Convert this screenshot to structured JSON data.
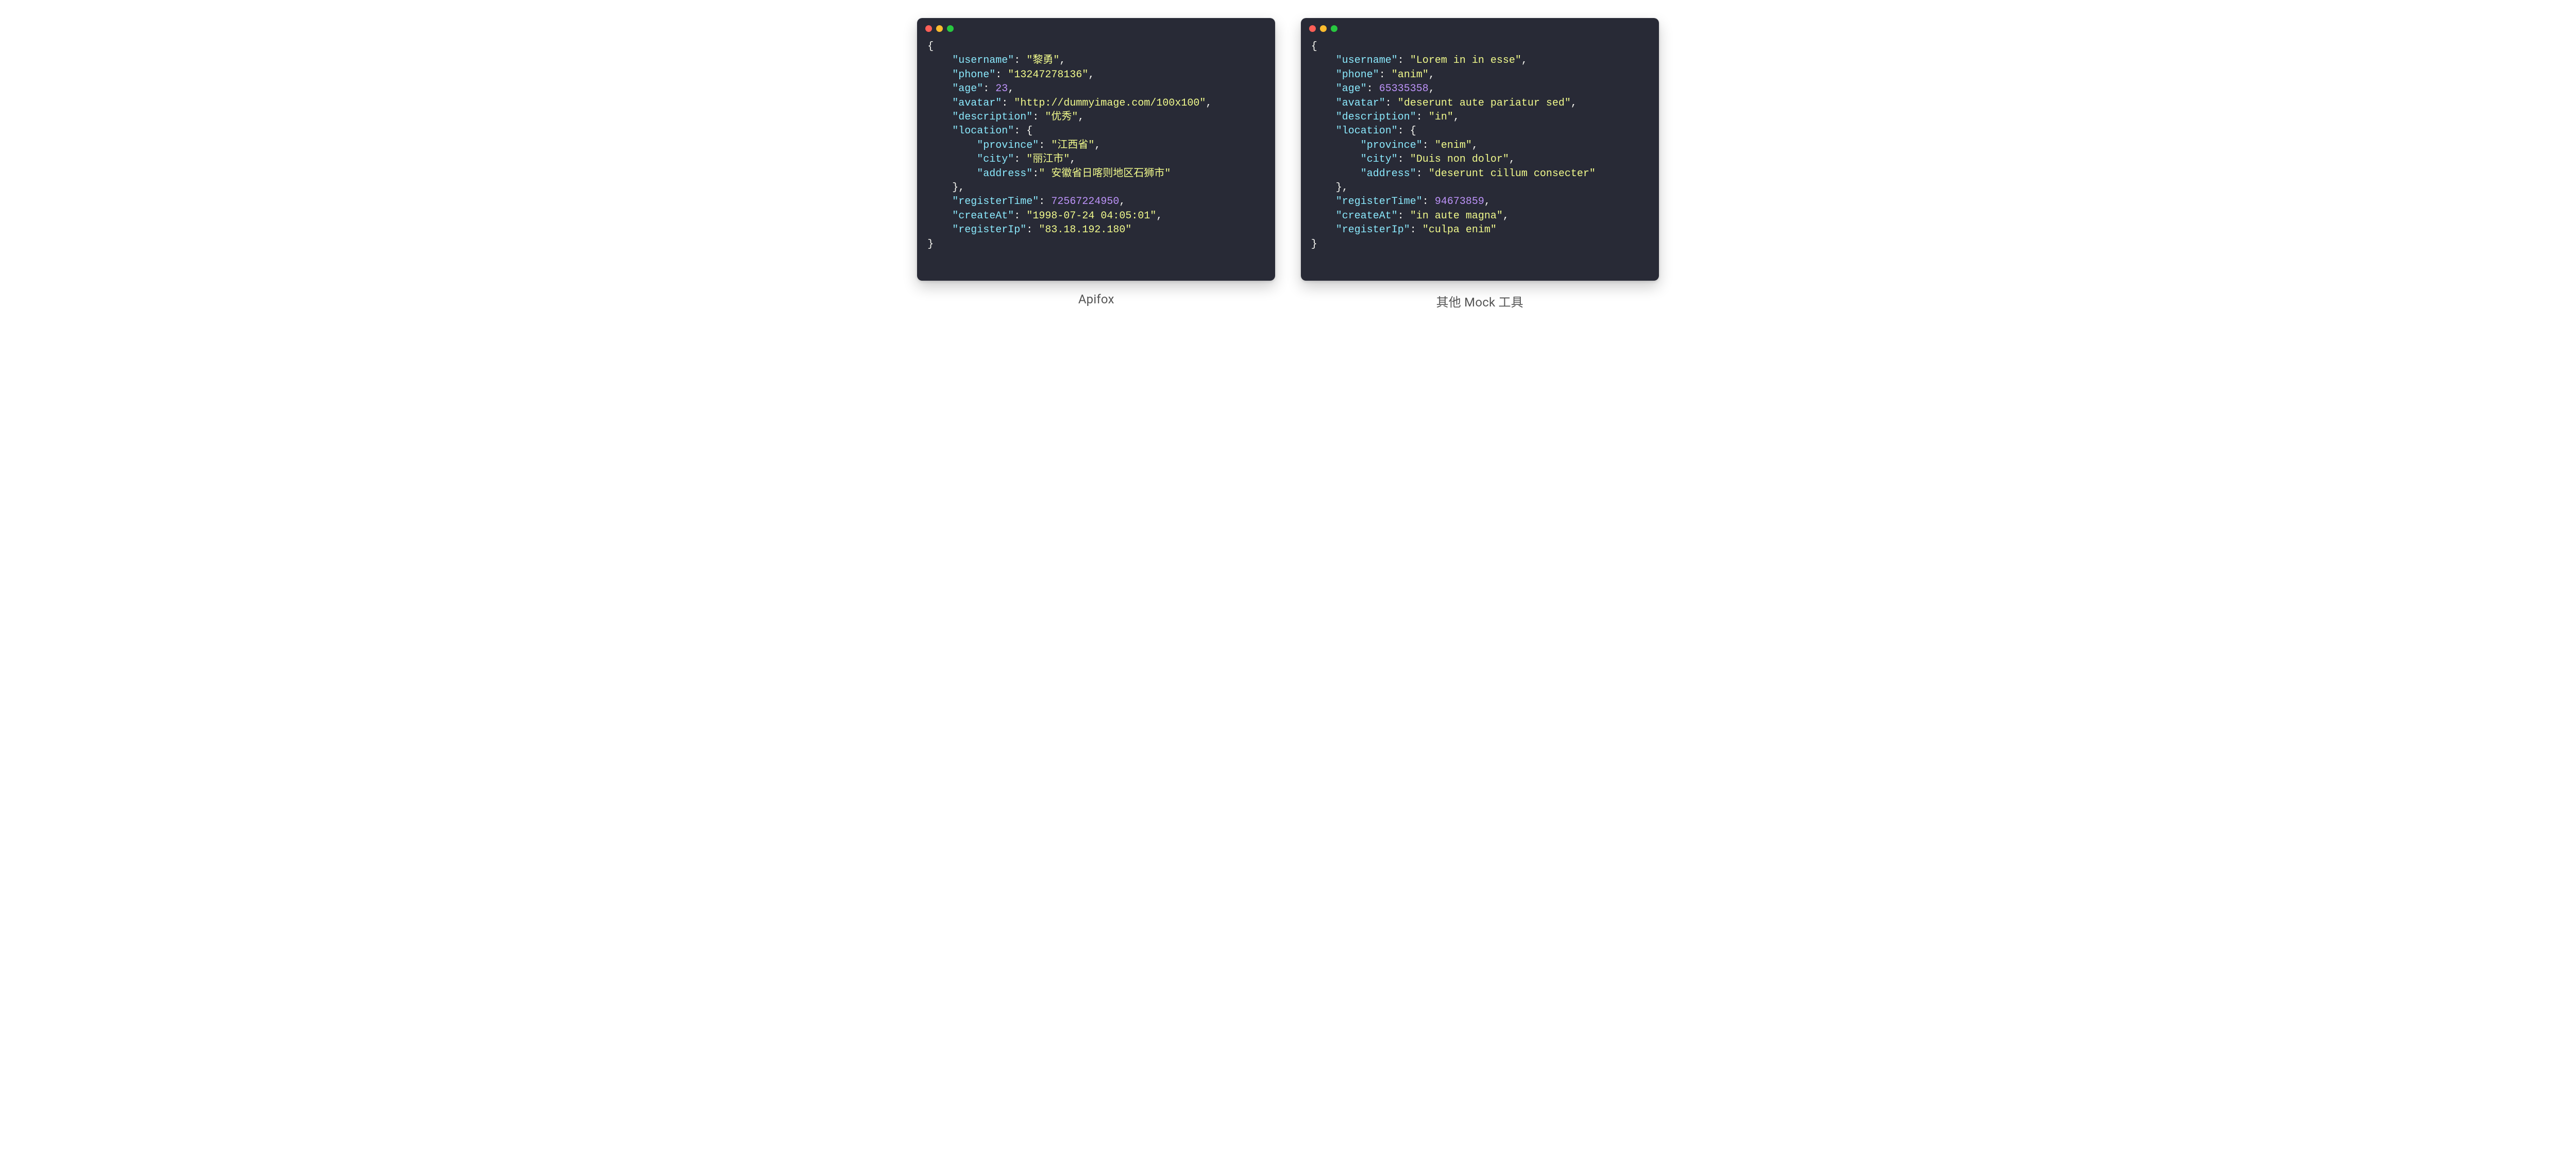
{
  "left": {
    "caption": "Apifox",
    "json": {
      "username": "黎勇",
      "phone": "13247278136",
      "age": 23,
      "avatar": "http://dummyimage.com/100x100",
      "description": "优秀",
      "location": {
        "province": "江西省",
        "city": "丽江市",
        "address": " 安徽省日喀则地区石狮市"
      },
      "registerTime": 72567224950,
      "createAt": "1998-07-24 04:05:01",
      "registerIp": "83.18.192.180"
    }
  },
  "right": {
    "caption": "其他 Mock 工具",
    "json": {
      "username": "Lorem in in esse",
      "phone": "anim",
      "age": 65335358,
      "avatar": "deserunt aute pariatur sed",
      "description": "in",
      "location": {
        "province": "enim",
        "city": "Duis non dolor",
        "address": "deserunt cillum consecter"
      },
      "registerTime": 94673859,
      "createAt": "in aute magna",
      "registerIp": "culpa enim"
    }
  },
  "left_address_format": "no-space-after-colon"
}
